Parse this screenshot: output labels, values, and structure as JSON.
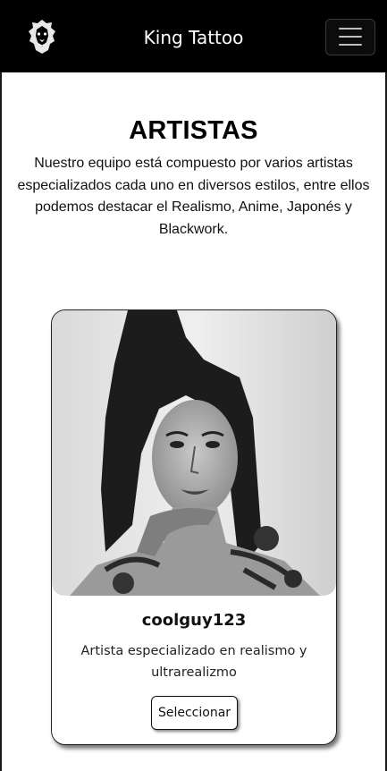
{
  "navbar": {
    "brand": "King Tattoo",
    "logo_icon": "lion-head-icon",
    "menu_icon": "hamburger-menu-icon"
  },
  "artists_section": {
    "title": "ARTISTAS",
    "description": "Nuestro equipo está compuesto por varios artistas especializados cada uno en diversos estilos, entre ellos podemos destacar el Realismo, Anime, Japonés y Blackwork."
  },
  "artist_card": {
    "name": "coolguy123",
    "description": "Artista especializado en realismo y ultrarealizmo",
    "button_label": "Seleccionar"
  },
  "colors": {
    "navbar_bg": "#000000",
    "navbar_text": "#ffffff",
    "page_bg": "#ffffff"
  }
}
